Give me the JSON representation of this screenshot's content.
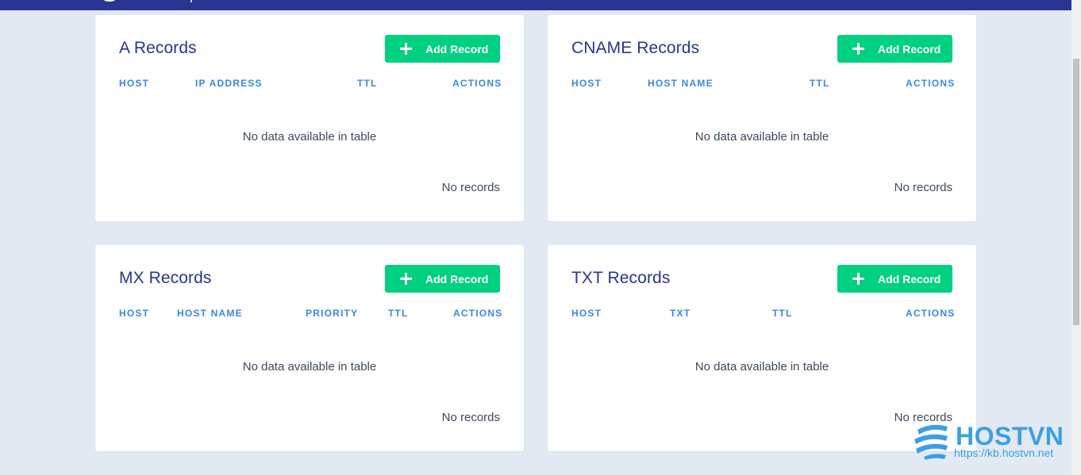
{
  "colors": {
    "header": "#283593",
    "background": "#e3e9f3",
    "accent_button": "#00d081",
    "column_header": "#3b86e6",
    "title": "#283593"
  },
  "add_button_label": "Add Record",
  "add_button_icon": "plus-icon",
  "cards": [
    {
      "id": "a",
      "title": "A Records",
      "columns": [
        "HOST",
        "IP ADDRESS",
        "TTL",
        "ACTIONS"
      ],
      "empty_text": "No data available in table",
      "count_text": "No records"
    },
    {
      "id": "cname",
      "title": "CNAME Records",
      "columns": [
        "HOST",
        "HOST NAME",
        "TTL",
        "ACTIONS"
      ],
      "empty_text": "No data available in table",
      "count_text": "No records"
    },
    {
      "id": "mx",
      "title": "MX Records",
      "columns": [
        "HOST",
        "HOST NAME",
        "PRIORITY",
        "TTL",
        "ACTIONS"
      ],
      "empty_text": "No data available in table",
      "count_text": "No records"
    },
    {
      "id": "txt",
      "title": "TXT Records",
      "columns": [
        "HOST",
        "TXT",
        "TTL",
        "ACTIONS"
      ],
      "empty_text": "No data available in table",
      "count_text": "No records"
    }
  ],
  "watermark": {
    "brand": "HOSTVN",
    "url": "https://kb.hostvn.net",
    "icon": "hostvn-logo-icon"
  }
}
